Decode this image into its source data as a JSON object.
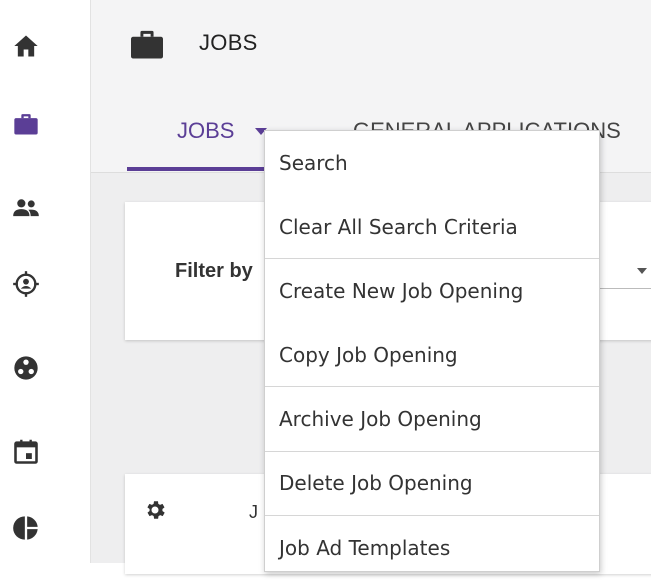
{
  "colors": {
    "accent": "#5b3e96",
    "icon": "#333333"
  },
  "sidebar": {
    "items": [
      {
        "icon": "home-icon"
      },
      {
        "icon": "briefcase-icon"
      },
      {
        "icon": "people-icon"
      },
      {
        "icon": "target-person-icon"
      },
      {
        "icon": "network-icon"
      },
      {
        "icon": "calendar-icon"
      },
      {
        "icon": "pie-chart-icon"
      }
    ]
  },
  "header": {
    "title": "JOBS",
    "icon": "briefcase-icon"
  },
  "tabs": [
    {
      "label": "JOBS",
      "active": true
    },
    {
      "label": "GENERAL APPLICATIONS",
      "active": false
    }
  ],
  "filter": {
    "label": "Filter by"
  },
  "list": {
    "settings_icon": "gear-icon",
    "column_header": "J"
  },
  "menu": {
    "items": [
      "Search",
      "Clear All Search Criteria",
      "Create New Job Opening",
      "Copy Job Opening",
      "Archive Job Opening",
      "Delete Job Opening",
      "Job Ad Templates"
    ]
  }
}
